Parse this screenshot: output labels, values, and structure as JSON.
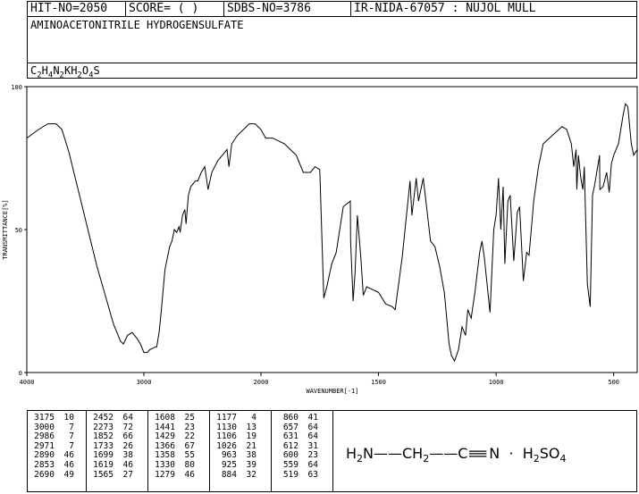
{
  "header": {
    "hit_no": "HIT-NO=2050",
    "score": "SCORE=  (   )",
    "sdbs_no": "SDBS-NO=3786",
    "ir_info": "IR-NIDA-67057 : NUJOL MULL",
    "compound_name": "AMINOACETONITRILE HYDROGENSULFATE",
    "formula_parts": [
      "C",
      "2",
      "H",
      "4",
      "N",
      "2",
      "KH",
      "2",
      "O",
      "4",
      "S"
    ]
  },
  "chart_data": {
    "type": "line",
    "xlabel": "WAVENUMBER[-1]",
    "ylabel": "TRANSMITTANCE[%]",
    "xlim": [
      4000,
      400
    ],
    "ylim": [
      0,
      100
    ],
    "x_ticks": [
      4000,
      3000,
      2000,
      1500,
      1000,
      500
    ],
    "y_ticks": [
      0,
      50,
      100
    ],
    "x_tick_labels": [
      "4000",
      "3000",
      "2000",
      "1500",
      "1000",
      "500"
    ],
    "y_tick_labels": [
      "0",
      "50",
      "100"
    ],
    "spectrum": [
      [
        4000,
        82
      ],
      [
        3900,
        85
      ],
      [
        3820,
        87
      ],
      [
        3750,
        87
      ],
      [
        3700,
        85
      ],
      [
        3640,
        77
      ],
      [
        3580,
        67
      ],
      [
        3520,
        57
      ],
      [
        3460,
        47
      ],
      [
        3400,
        37
      ],
      [
        3330,
        27
      ],
      [
        3260,
        17
      ],
      [
        3200,
        11
      ],
      [
        3175,
        10
      ],
      [
        3140,
        13
      ],
      [
        3100,
        14
      ],
      [
        3060,
        12
      ],
      [
        3030,
        10
      ],
      [
        3000,
        7
      ],
      [
        2986,
        7
      ],
      [
        2971,
        7
      ],
      [
        2950,
        8
      ],
      [
        2900,
        9
      ],
      [
        2890,
        9
      ],
      [
        2870,
        14
      ],
      [
        2853,
        21
      ],
      [
        2820,
        36
      ],
      [
        2780,
        44
      ],
      [
        2760,
        46
      ],
      [
        2740,
        50
      ],
      [
        2720,
        49
      ],
      [
        2700,
        51
      ],
      [
        2690,
        49
      ],
      [
        2670,
        55
      ],
      [
        2650,
        57
      ],
      [
        2640,
        52
      ],
      [
        2620,
        62
      ],
      [
        2600,
        65
      ],
      [
        2560,
        67
      ],
      [
        2540,
        67
      ],
      [
        2510,
        70
      ],
      [
        2480,
        72
      ],
      [
        2452,
        64
      ],
      [
        2420,
        70
      ],
      [
        2370,
        74
      ],
      [
        2330,
        76
      ],
      [
        2290,
        78
      ],
      [
        2273,
        72
      ],
      [
        2250,
        80
      ],
      [
        2200,
        83
      ],
      [
        2150,
        85
      ],
      [
        2100,
        87
      ],
      [
        2050,
        87
      ],
      [
        2000,
        85
      ],
      [
        1980,
        82
      ],
      [
        1950,
        82
      ],
      [
        1900,
        80
      ],
      [
        1850,
        76
      ],
      [
        1820,
        70
      ],
      [
        1790,
        70
      ],
      [
        1770,
        72
      ],
      [
        1750,
        71
      ],
      [
        1733,
        26
      ],
      [
        1720,
        30
      ],
      [
        1699,
        38
      ],
      [
        1680,
        42
      ],
      [
        1650,
        58
      ],
      [
        1620,
        60
      ],
      [
        1619,
        46
      ],
      [
        1608,
        25
      ],
      [
        1600,
        35
      ],
      [
        1590,
        55
      ],
      [
        1575,
        40
      ],
      [
        1565,
        27
      ],
      [
        1550,
        30
      ],
      [
        1500,
        28
      ],
      [
        1470,
        24
      ],
      [
        1441,
        23
      ],
      [
        1429,
        22
      ],
      [
        1400,
        40
      ],
      [
        1366,
        67
      ],
      [
        1358,
        55
      ],
      [
        1340,
        68
      ],
      [
        1330,
        60
      ],
      [
        1310,
        68
      ],
      [
        1279,
        46
      ],
      [
        1260,
        44
      ],
      [
        1240,
        37
      ],
      [
        1220,
        28
      ],
      [
        1200,
        10
      ],
      [
        1190,
        6
      ],
      [
        1177,
        4
      ],
      [
        1160,
        8
      ],
      [
        1145,
        16
      ],
      [
        1130,
        13
      ],
      [
        1120,
        22
      ],
      [
        1106,
        19
      ],
      [
        1090,
        28
      ],
      [
        1070,
        42
      ],
      [
        1060,
        46
      ],
      [
        1050,
        40
      ],
      [
        1026,
        21
      ],
      [
        1010,
        50
      ],
      [
        1000,
        55
      ],
      [
        990,
        68
      ],
      [
        980,
        50
      ],
      [
        970,
        65
      ],
      [
        963,
        38
      ],
      [
        950,
        60
      ],
      [
        940,
        62
      ],
      [
        925,
        39
      ],
      [
        910,
        56
      ],
      [
        900,
        58
      ],
      [
        884,
        32
      ],
      [
        870,
        42
      ],
      [
        860,
        41
      ],
      [
        840,
        60
      ],
      [
        820,
        72
      ],
      [
        800,
        80
      ],
      [
        760,
        83
      ],
      [
        720,
        86
      ],
      [
        700,
        85
      ],
      [
        680,
        80
      ],
      [
        670,
        72
      ],
      [
        660,
        78
      ],
      [
        657,
        64
      ],
      [
        650,
        76
      ],
      [
        640,
        68
      ],
      [
        631,
        64
      ],
      [
        625,
        72
      ],
      [
        612,
        31
      ],
      [
        600,
        23
      ],
      [
        590,
        62
      ],
      [
        580,
        66
      ],
      [
        560,
        76
      ],
      [
        559,
        64
      ],
      [
        545,
        65
      ],
      [
        530,
        70
      ],
      [
        519,
        63
      ],
      [
        510,
        73
      ],
      [
        500,
        76
      ],
      [
        480,
        80
      ],
      [
        460,
        90
      ],
      [
        450,
        94
      ],
      [
        440,
        93
      ],
      [
        425,
        80
      ],
      [
        415,
        76
      ],
      [
        400,
        78
      ]
    ],
    "peak_table": [
      [
        3175,
        10
      ],
      [
        3000,
        7
      ],
      [
        2986,
        7
      ],
      [
        2971,
        7
      ],
      [
        2890,
        46
      ],
      [
        2853,
        46
      ],
      [
        2690,
        49
      ],
      [
        2452,
        64
      ],
      [
        2273,
        72
      ],
      [
        1852,
        66
      ],
      [
        1733,
        26
      ],
      [
        1699,
        38
      ],
      [
        1619,
        46
      ],
      [
        1565,
        27
      ],
      [
        1608,
        25
      ],
      [
        1441,
        23
      ],
      [
        1429,
        22
      ],
      [
        1366,
        67
      ],
      [
        1358,
        55
      ],
      [
        1330,
        80
      ],
      [
        1279,
        46
      ],
      [
        1177,
        4
      ],
      [
        1130,
        13
      ],
      [
        1106,
        19
      ],
      [
        1026,
        21
      ],
      [
        963,
        38
      ],
      [
        925,
        39
      ],
      [
        884,
        32
      ],
      [
        860,
        41
      ],
      [
        657,
        64
      ],
      [
        631,
        64
      ],
      [
        612,
        31
      ],
      [
        600,
        23
      ],
      [
        559,
        64
      ],
      [
        519,
        63
      ]
    ],
    "grid": false
  },
  "structure": {
    "h2n": "H",
    "h2n_sub": "2",
    "n": "N",
    "bond1": "——",
    "ch2": "CH",
    "ch2_sub": "2",
    "bond2": "——C",
    "triple": "≡≡",
    "nitrile_n": "N",
    "dot": "·",
    "h2so4_h": "H",
    "h2so4_sub1": "2",
    "h2so4_so": "SO",
    "h2so4_sub2": "4"
  }
}
